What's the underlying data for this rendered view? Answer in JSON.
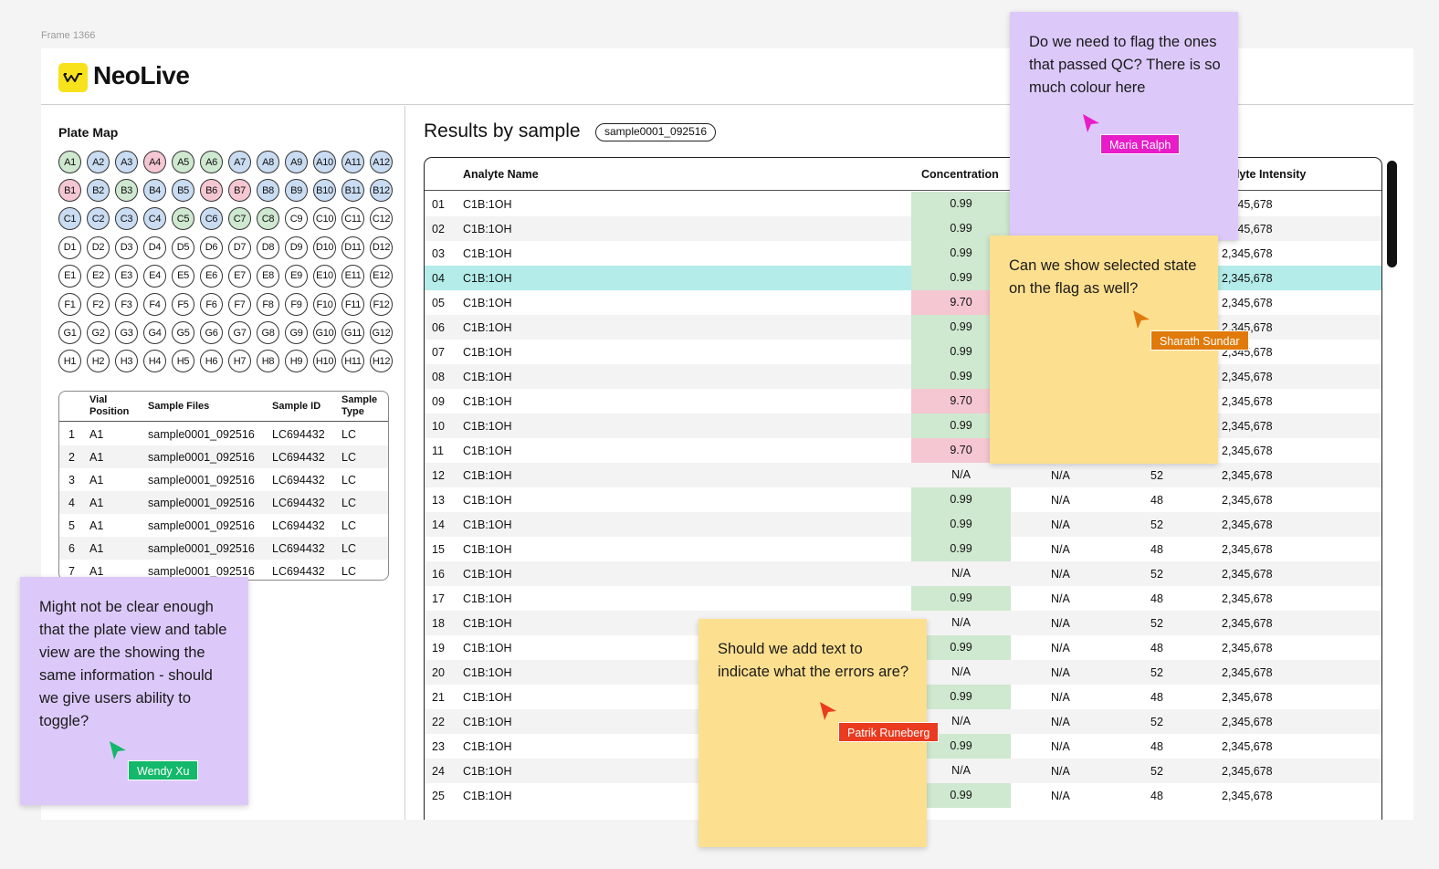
{
  "frame_label": "Frame 1366",
  "app": {
    "name": "NeoLive"
  },
  "plate_map": {
    "title": "Plate Map",
    "rows": [
      [
        [
          "A1",
          "g"
        ],
        [
          "A2",
          "b"
        ],
        [
          "A3",
          "b"
        ],
        [
          "A4",
          "r"
        ],
        [
          "A5",
          "g"
        ],
        [
          "A6",
          "g"
        ],
        [
          "A7",
          "b"
        ],
        [
          "A8",
          "b"
        ],
        [
          "A9",
          "b"
        ],
        [
          "A10",
          "b"
        ],
        [
          "A11",
          "b"
        ],
        [
          "A12",
          "b"
        ]
      ],
      [
        [
          "B1",
          "r"
        ],
        [
          "B2",
          "b"
        ],
        [
          "B3",
          "g"
        ],
        [
          "B4",
          "b"
        ],
        [
          "B5",
          "b"
        ],
        [
          "B6",
          "r"
        ],
        [
          "B7",
          "r"
        ],
        [
          "B8",
          "b"
        ],
        [
          "B9",
          "b"
        ],
        [
          "B10",
          "b"
        ],
        [
          "B11",
          "b"
        ],
        [
          "B12",
          "b"
        ]
      ],
      [
        [
          "C1",
          "b"
        ],
        [
          "C2",
          "b"
        ],
        [
          "C3",
          "b"
        ],
        [
          "C4",
          "b"
        ],
        [
          "C5",
          "g"
        ],
        [
          "C6",
          "b"
        ],
        [
          "C7",
          "g"
        ],
        [
          "C8",
          "g"
        ],
        [
          "C9",
          "w"
        ],
        [
          "C10",
          "w"
        ],
        [
          "C11",
          "w"
        ],
        [
          "C12",
          "w"
        ]
      ],
      [
        [
          "D1",
          "w"
        ],
        [
          "D2",
          "w"
        ],
        [
          "D3",
          "w"
        ],
        [
          "D4",
          "w"
        ],
        [
          "D5",
          "w"
        ],
        [
          "D6",
          "w"
        ],
        [
          "D7",
          "w"
        ],
        [
          "D8",
          "w"
        ],
        [
          "D9",
          "w"
        ],
        [
          "D10",
          "w"
        ],
        [
          "D11",
          "w"
        ],
        [
          "D12",
          "w"
        ]
      ],
      [
        [
          "E1",
          "w"
        ],
        [
          "E2",
          "w"
        ],
        [
          "E3",
          "w"
        ],
        [
          "E4",
          "w"
        ],
        [
          "E5",
          "w"
        ],
        [
          "E6",
          "w"
        ],
        [
          "E7",
          "w"
        ],
        [
          "E8",
          "w"
        ],
        [
          "E9",
          "w"
        ],
        [
          "E10",
          "w"
        ],
        [
          "E11",
          "w"
        ],
        [
          "E12",
          "w"
        ]
      ],
      [
        [
          "F1",
          "w"
        ],
        [
          "F2",
          "w"
        ],
        [
          "F3",
          "w"
        ],
        [
          "F4",
          "w"
        ],
        [
          "F5",
          "w"
        ],
        [
          "F6",
          "w"
        ],
        [
          "F7",
          "w"
        ],
        [
          "F8",
          "w"
        ],
        [
          "F9",
          "w"
        ],
        [
          "F10",
          "w"
        ],
        [
          "F11",
          "w"
        ],
        [
          "F12",
          "w"
        ]
      ],
      [
        [
          "G1",
          "w"
        ],
        [
          "G2",
          "w"
        ],
        [
          "G3",
          "w"
        ],
        [
          "G4",
          "w"
        ],
        [
          "G5",
          "w"
        ],
        [
          "G6",
          "w"
        ],
        [
          "G7",
          "w"
        ],
        [
          "G8",
          "w"
        ],
        [
          "G9",
          "w"
        ],
        [
          "G10",
          "w"
        ],
        [
          "G11",
          "w"
        ],
        [
          "G12",
          "w"
        ]
      ],
      [
        [
          "H1",
          "w"
        ],
        [
          "H2",
          "w"
        ],
        [
          "H3",
          "w"
        ],
        [
          "H4",
          "w"
        ],
        [
          "H5",
          "w"
        ],
        [
          "H6",
          "w"
        ],
        [
          "H7",
          "w"
        ],
        [
          "H8",
          "w"
        ],
        [
          "H9",
          "w"
        ],
        [
          "H10",
          "w"
        ],
        [
          "H11",
          "w"
        ],
        [
          "H12",
          "w"
        ]
      ]
    ]
  },
  "sample_table": {
    "headers": {
      "vial_line1": "Vial",
      "vial_line2": "Position",
      "files": "Sample Files",
      "id": "Sample ID",
      "type_line1": "Sample",
      "type_line2": "Type"
    },
    "rows": [
      [
        "1",
        "A1",
        "sample0001_092516",
        "LC694432",
        "LC"
      ],
      [
        "2",
        "A1",
        "sample0001_092516",
        "LC694432",
        "LC"
      ],
      [
        "3",
        "A1",
        "sample0001_092516",
        "LC694432",
        "LC"
      ],
      [
        "4",
        "A1",
        "sample0001_092516",
        "LC694432",
        "LC"
      ],
      [
        "5",
        "A1",
        "sample0001_092516",
        "LC694432",
        "LC"
      ],
      [
        "6",
        "A1",
        "sample0001_092516",
        "LC694432",
        "LC"
      ],
      [
        "7",
        "A1",
        "sample0001_092516",
        "LC694432",
        "LC"
      ]
    ]
  },
  "results": {
    "title": "Results by sample",
    "sample_pill": "sample0001_092516",
    "headers": {
      "analyte": "Analyte Name",
      "concentration": "Concentration",
      "intensity": "alyte Intensity"
    },
    "rows": [
      [
        "01",
        "C1B:1OH",
        "0.99",
        "ok",
        "",
        "",
        "2,345,678"
      ],
      [
        "02",
        "C1B:1OH",
        "0.99",
        "ok",
        "",
        "",
        "2,345,678"
      ],
      [
        "03",
        "C1B:1OH",
        "0.99",
        "ok",
        "",
        "",
        "2,345,678"
      ],
      [
        "04",
        "C1B:1OH",
        "0.99",
        "ok",
        "",
        "",
        "2,345,678"
      ],
      [
        "05",
        "C1B:1OH",
        "9.70",
        "err",
        "",
        "",
        "2,345,678"
      ],
      [
        "06",
        "C1B:1OH",
        "0.99",
        "ok",
        "",
        "",
        "2,345,678"
      ],
      [
        "07",
        "C1B:1OH",
        "0.99",
        "ok",
        "",
        "",
        "2,345,678"
      ],
      [
        "08",
        "C1B:1OH",
        "0.99",
        "ok",
        "",
        "",
        "2,345,678"
      ],
      [
        "09",
        "C1B:1OH",
        "9.70",
        "err",
        "",
        "",
        "2,345,678"
      ],
      [
        "10",
        "C1B:1OH",
        "0.99",
        "ok",
        "",
        "",
        "2,345,678"
      ],
      [
        "11",
        "C1B:1OH",
        "9.70",
        "err",
        "",
        "",
        "2,345,678"
      ],
      [
        "12",
        "C1B:1OH",
        "N/A",
        "none",
        "N/A",
        "52",
        "2,345,678"
      ],
      [
        "13",
        "C1B:1OH",
        "0.99",
        "ok",
        "N/A",
        "48",
        "2,345,678"
      ],
      [
        "14",
        "C1B:1OH",
        "0.99",
        "ok",
        "N/A",
        "52",
        "2,345,678"
      ],
      [
        "15",
        "C1B:1OH",
        "0.99",
        "ok",
        "N/A",
        "48",
        "2,345,678"
      ],
      [
        "16",
        "C1B:1OH",
        "N/A",
        "none",
        "N/A",
        "52",
        "2,345,678"
      ],
      [
        "17",
        "C1B:1OH",
        "0.99",
        "ok",
        "N/A",
        "48",
        "2,345,678"
      ],
      [
        "18",
        "C1B:1OH",
        "N/A",
        "none",
        "N/A",
        "52",
        "2,345,678"
      ],
      [
        "19",
        "C1B:1OH",
        "0.99",
        "ok",
        "N/A",
        "48",
        "2,345,678"
      ],
      [
        "20",
        "C1B:1OH",
        "N/A",
        "none",
        "N/A",
        "52",
        "2,345,678"
      ],
      [
        "21",
        "C1B:1OH",
        "0.99",
        "ok",
        "N/A",
        "48",
        "2,345,678"
      ],
      [
        "22",
        "C1B:1OH",
        "N/A",
        "none",
        "N/A",
        "52",
        "2,345,678"
      ],
      [
        "23",
        "C1B:1OH",
        "0.99",
        "ok",
        "N/A",
        "48",
        "2,345,678"
      ],
      [
        "24",
        "C1B:1OH",
        "N/A",
        "none",
        "N/A",
        "52",
        "2,345,678"
      ],
      [
        "25",
        "C1B:1OH",
        "0.99",
        "ok",
        "N/A",
        "48",
        "2,345,678"
      ]
    ],
    "selected_row": "04"
  },
  "comments": {
    "maria": {
      "text": "Do we need to flag the ones that passed QC? There is so much colour here",
      "author": "Maria Ralph",
      "color": "#e81cc9"
    },
    "sharath": {
      "text": "Can we show selected state on the flag as well?",
      "author": "Sharath Sundar",
      "color": "#e07a0b"
    },
    "wendy": {
      "text": "Might not be clear enough that the plate view and table view are the showing the same information - should we give users ability to toggle?",
      "author": "Wendy Xu",
      "color": "#13b86b"
    },
    "patrik": {
      "text": "Should we add text to indicate what the errors are?",
      "author": "Patrik Runeberg",
      "color": "#ea3a1f"
    }
  }
}
